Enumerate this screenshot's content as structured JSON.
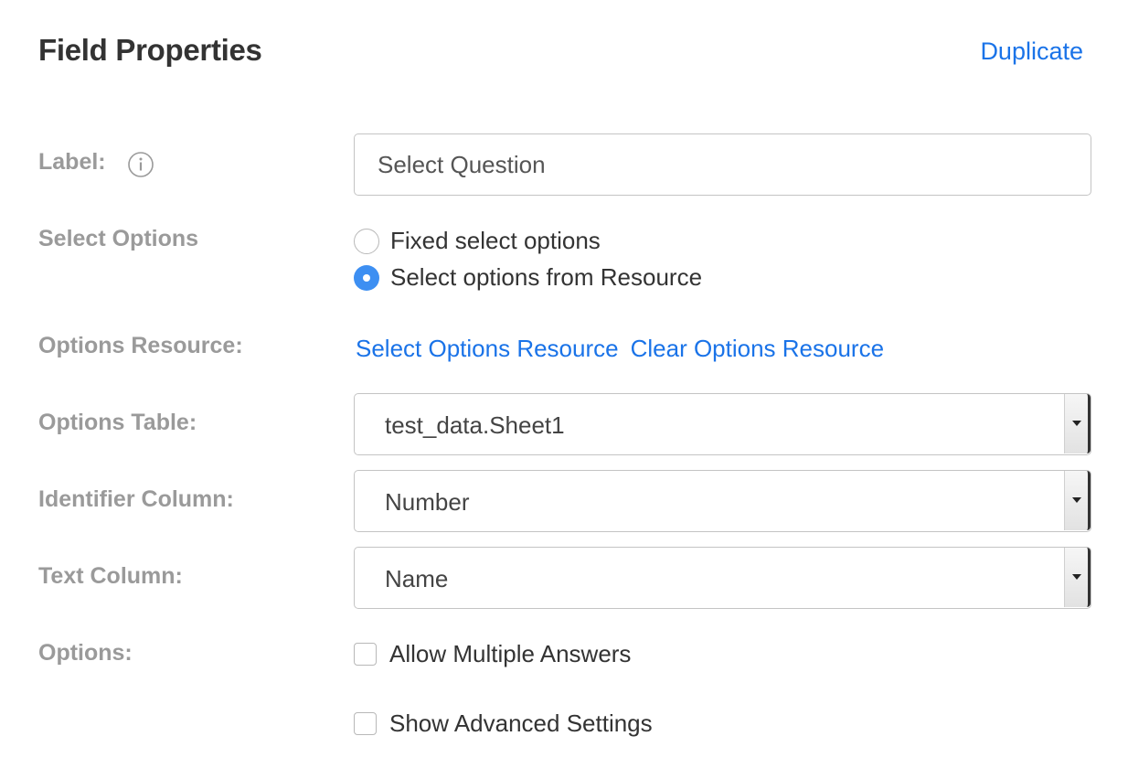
{
  "header": {
    "title": "Field Properties",
    "duplicate_label": "Duplicate"
  },
  "label_row": {
    "label": "Label:",
    "info_icon": "info-circle-icon",
    "value": "Select Question"
  },
  "select_options": {
    "label": "Select Options",
    "options": [
      {
        "label": "Fixed select options",
        "checked": false
      },
      {
        "label": "Select options from Resource",
        "checked": true
      }
    ]
  },
  "options_resource": {
    "label": "Options Resource:",
    "select_link": "Select Options Resource",
    "clear_link": "Clear Options Resource"
  },
  "options_table": {
    "label": "Options Table:",
    "value": "test_data.Sheet1"
  },
  "identifier_column": {
    "label": "Identifier Column:",
    "value": "Number"
  },
  "text_column": {
    "label": "Text Column:",
    "value": "Name"
  },
  "options": {
    "label": "Options:",
    "allow_multiple": {
      "label": "Allow Multiple Answers",
      "checked": false
    },
    "show_advanced": {
      "label": "Show Advanced Settings",
      "checked": false
    }
  },
  "colors": {
    "link": "#1a73e8",
    "radio_selected": "#3d8ff2",
    "label_gray": "#9a9a9a"
  }
}
